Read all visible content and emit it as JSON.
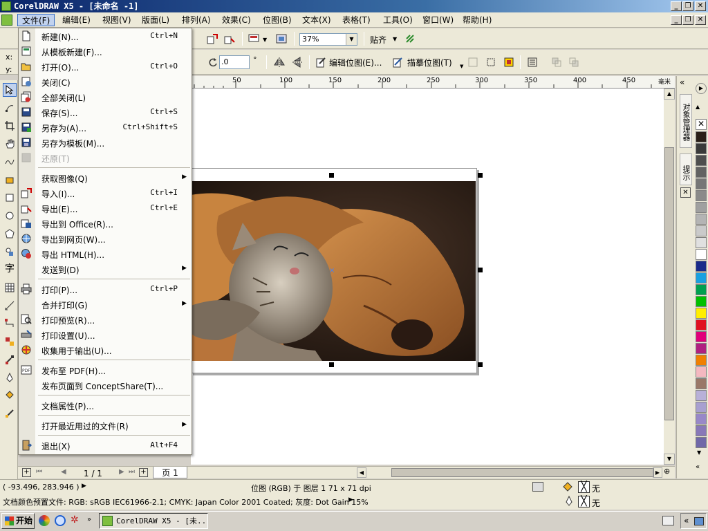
{
  "window": {
    "title": "CorelDRAW X5 - [未命名 -1]"
  },
  "menubar": {
    "items": [
      "文件(F)",
      "编辑(E)",
      "视图(V)",
      "版面(L)",
      "排列(A)",
      "效果(C)",
      "位图(B)",
      "文本(X)",
      "表格(T)",
      "工具(O)",
      "窗口(W)",
      "帮助(H)"
    ]
  },
  "toolbar": {
    "zoom": "37%",
    "snap_label": "贴齐"
  },
  "propbar": {
    "x_label": "x:",
    "y_label": "y:",
    "rotation": ".0",
    "deg": "°",
    "edit_bitmap": "编辑位图(E)...",
    "trace_bitmap": "描摹位图(T)"
  },
  "ruler": {
    "ticks": [
      "50",
      "100",
      "150",
      "200",
      "250",
      "300",
      "350",
      "400",
      "450"
    ],
    "unit": "毫米"
  },
  "file_menu": {
    "items": [
      {
        "label": "新建(N)...",
        "shortcut": "Ctrl+N"
      },
      {
        "label": "从模板新建(F)...",
        "shortcut": ""
      },
      {
        "label": "打开(O)...",
        "shortcut": "Ctrl+O"
      },
      {
        "label": "关闭(C)",
        "shortcut": ""
      },
      {
        "label": "全部关闭(L)",
        "shortcut": ""
      },
      {
        "label": "保存(S)...",
        "shortcut": "Ctrl+S"
      },
      {
        "label": "另存为(A)...",
        "shortcut": "Ctrl+Shift+S"
      },
      {
        "label": "另存为模板(M)...",
        "shortcut": ""
      },
      {
        "label": "还原(T)",
        "shortcut": ""
      },
      {
        "label": "获取图像(Q)",
        "shortcut": ""
      },
      {
        "label": "导入(I)...",
        "shortcut": "Ctrl+I"
      },
      {
        "label": "导出(E)...",
        "shortcut": "Ctrl+E"
      },
      {
        "label": "导出到 Office(R)...",
        "shortcut": ""
      },
      {
        "label": "导出到网页(W)...",
        "shortcut": ""
      },
      {
        "label": "导出 HTML(H)...",
        "shortcut": ""
      },
      {
        "label": "发送到(D)",
        "shortcut": ""
      },
      {
        "label": "打印(P)...",
        "shortcut": "Ctrl+P"
      },
      {
        "label": "合并打印(G)",
        "shortcut": ""
      },
      {
        "label": "打印预览(R)...",
        "shortcut": ""
      },
      {
        "label": "打印设置(U)...",
        "shortcut": ""
      },
      {
        "label": "收集用于输出(U)...",
        "shortcut": ""
      },
      {
        "label": "发布至 PDF(H)...",
        "shortcut": ""
      },
      {
        "label": "发布页面到 ConceptShare(T)...",
        "shortcut": ""
      },
      {
        "label": "文档属性(P)...",
        "shortcut": ""
      },
      {
        "label": "打开最近用过的文件(R)",
        "shortcut": ""
      },
      {
        "label": "退出(X)",
        "shortcut": "Alt+F4"
      }
    ]
  },
  "docker": {
    "object_manager": "对象管理器",
    "hints": "提示"
  },
  "page_nav": {
    "page_count": "1 / 1",
    "page_tab": "页 1"
  },
  "status": {
    "coords": "( -93.496, 283.946 )",
    "object_info": "位图 (RGB) 于 图层 1 71 x 71 dpi",
    "fill_none": "无",
    "outline_none": "无",
    "color_profile": "文档颜色预置文件: RGB: sRGB IEC61966-2.1; CMYK: Japan Color 2001 Coated; 灰度: Dot Gain 15%"
  },
  "taskbar": {
    "start": "开始",
    "task": "CorelDRAW X5 - [未..."
  },
  "palette_colors": [
    "#2a1f18",
    "#3a3a3a",
    "#4e4e4e",
    "#626262",
    "#767676",
    "#8a8a8a",
    "#a0a0a0",
    "#b4b4b4",
    "#cacaca",
    "#e0e0e0",
    "#ffffff",
    "#1a2a8a",
    "#1aa0e0",
    "#00a050",
    "#00c000",
    "#ffee00",
    "#e01020",
    "#e0007a",
    "#b02080",
    "#f08000",
    "#f4b8c0",
    "#9a7868",
    "#b8b0d8",
    "#a8a0d0",
    "#9888c8",
    "#8878b8",
    "#7068a8"
  ]
}
